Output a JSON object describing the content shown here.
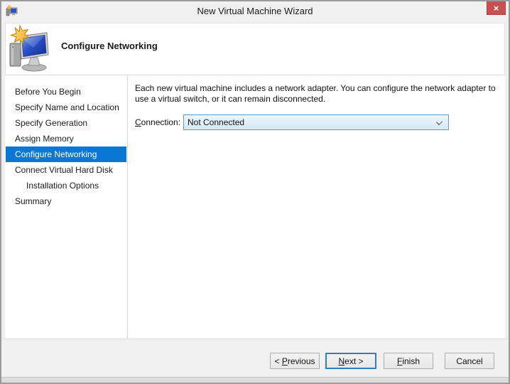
{
  "window": {
    "title": "New Virtual Machine Wizard",
    "close_glyph": "×"
  },
  "header": {
    "title": "Configure Networking"
  },
  "sidebar": {
    "items": [
      {
        "label": "Before You Begin",
        "selected": false,
        "indented": false
      },
      {
        "label": "Specify Name and Location",
        "selected": false,
        "indented": false
      },
      {
        "label": "Specify Generation",
        "selected": false,
        "indented": false
      },
      {
        "label": "Assign Memory",
        "selected": false,
        "indented": false
      },
      {
        "label": "Configure Networking",
        "selected": true,
        "indented": false
      },
      {
        "label": "Connect Virtual Hard Disk",
        "selected": false,
        "indented": false
      },
      {
        "label": "Installation Options",
        "selected": false,
        "indented": true
      },
      {
        "label": "Summary",
        "selected": false,
        "indented": false
      }
    ]
  },
  "content": {
    "description": "Each new virtual machine includes a network adapter. You can configure the network adapter to use a virtual switch, or it can remain disconnected.",
    "connection_label": {
      "key": "C",
      "rest": "onnection:"
    },
    "connection_value": "Not Connected"
  },
  "footer": {
    "previous": {
      "pre": "< ",
      "key": "P",
      "rest": "revious"
    },
    "next": {
      "pre": "",
      "key": "N",
      "rest": "ext >"
    },
    "finish": {
      "pre": "",
      "key": "F",
      "rest": "inish"
    },
    "cancel": {
      "label": "Cancel"
    }
  },
  "colors": {
    "selection-blue": "#0b77d4",
    "close-red": "#c75050",
    "default-button-border": "#2e7ec1",
    "combobox-border": "#5c9ccf"
  }
}
